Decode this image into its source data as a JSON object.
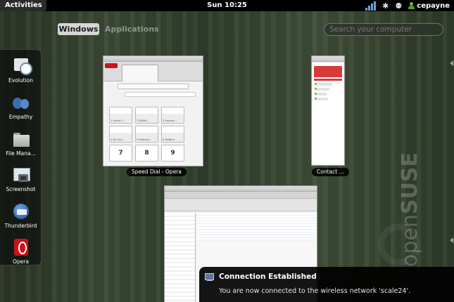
{
  "topbar": {
    "activities_label": "Activities",
    "clock": "Sun 10:25",
    "username": "cepayne",
    "bluetooth_glyph": "✱",
    "accessibility_glyph": "⚉",
    "icons": [
      "signal-strength-icon",
      "bluetooth-icon",
      "accessibility-icon",
      "user-icon"
    ]
  },
  "overview": {
    "tabs": [
      {
        "label": "Windows",
        "active": true
      },
      {
        "label": "Applications",
        "active": false
      }
    ],
    "search": {
      "placeholder": "Search your computer",
      "value": ""
    }
  },
  "dash": {
    "items": [
      {
        "label": "Evolution",
        "icon": "evolution-icon"
      },
      {
        "label": "Empathy",
        "icon": "empathy-icon"
      },
      {
        "label": "File Mana...",
        "icon": "file-manager-icon"
      },
      {
        "label": "Screenshot",
        "icon": "screenshot-icon"
      },
      {
        "label": "Thunderbird",
        "icon": "thunderbird-icon"
      },
      {
        "label": "Opera",
        "icon": "opera-icon"
      }
    ]
  },
  "windows": [
    {
      "caption": "Speed Dial - Opera",
      "speed_dial": [
        {
          "number": "",
          "caption": "1 Opera P..."
        },
        {
          "number": "",
          "caption": "2 KAYAK ..."
        },
        {
          "number": "",
          "caption": "3 Amazon..."
        },
        {
          "number": "",
          "caption": "4 My Ope..."
        },
        {
          "number": "",
          "caption": "5 Webcam..."
        },
        {
          "number": "",
          "caption": "6 TwitBird"
        },
        {
          "number": "7",
          "caption": ""
        },
        {
          "number": "8",
          "caption": ""
        },
        {
          "number": "9",
          "caption": ""
        }
      ]
    },
    {
      "caption": "Contact ..."
    },
    {
      "caption": ""
    }
  ],
  "watermark": {
    "brand_light": "open",
    "brand_bold": "SUSE"
  },
  "notification": {
    "title": "Connection Established",
    "body": "You are now connected to the wireless network 'scale24'.",
    "icon": "network-icon"
  }
}
